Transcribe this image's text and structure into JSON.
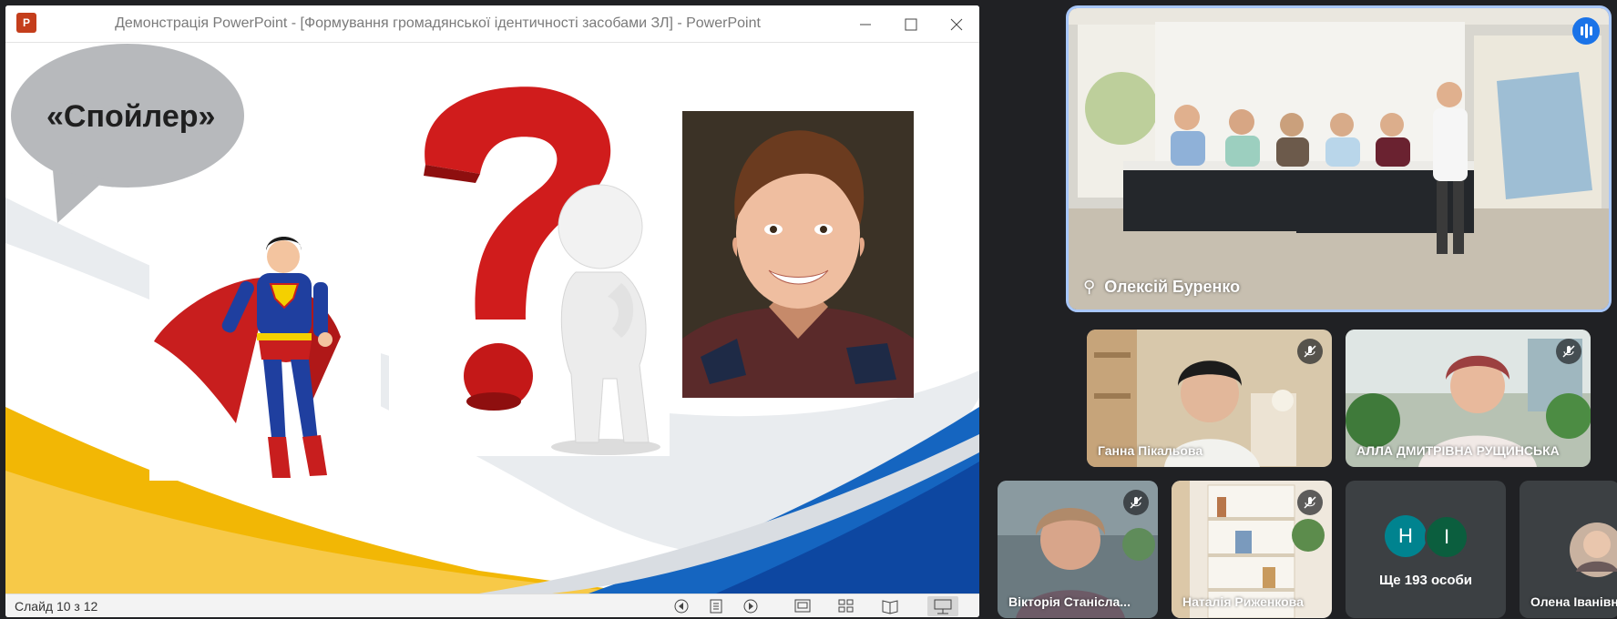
{
  "ppt": {
    "app_icon_letter": "P",
    "window_title": "Демонстрація PowerPoint - [Формування громадянської ідентичності засобами ЗЛ] - PowerPoint",
    "slide": {
      "bubble_text": "«Спойлер»"
    },
    "status": {
      "slide_counter": "Слайд 10 з 12"
    }
  },
  "meet": {
    "speaker": {
      "name": "Олексій Буренко"
    },
    "participants": [
      {
        "name": "Ганна Пікальова"
      },
      {
        "name": "АЛЛА ДМИТРІВНА РУЩИНСЬКА"
      },
      {
        "name": "Вікторія Станісла..."
      },
      {
        "name": "Наталія Риженкова"
      },
      {
        "name": "Олена Іванівн"
      }
    ],
    "more": {
      "text": "Ще 193 особи",
      "initials": [
        "Н",
        "І"
      ]
    }
  },
  "colors": {
    "accent_blue": "#1a73e8",
    "speaker_outline": "#a8c7fa",
    "ppt_red": "#c43e1c",
    "initial_teal": "#00838f",
    "initial_green": "#0b5e3e"
  }
}
